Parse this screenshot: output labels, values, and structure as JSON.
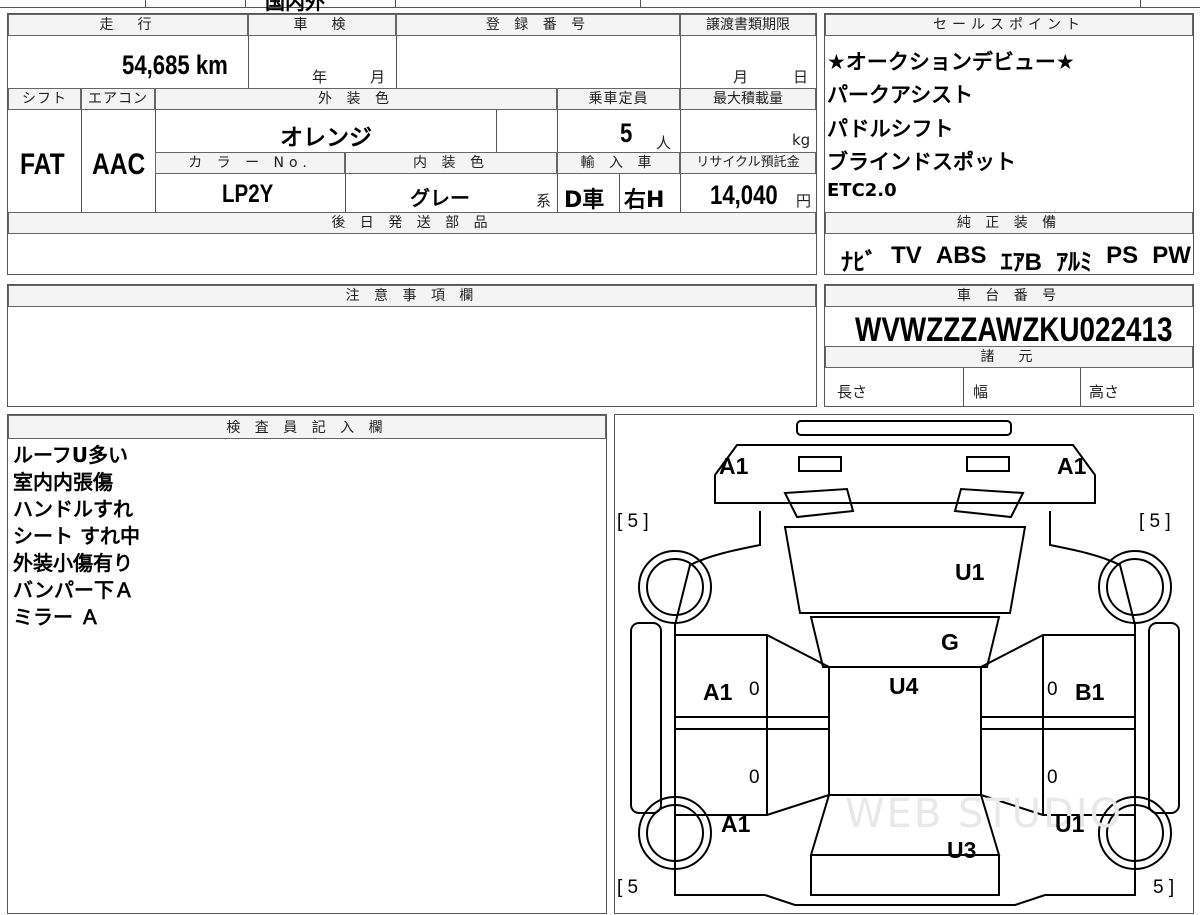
{
  "top_strip": {
    "label": "国内外"
  },
  "vehicle": {
    "mileage_header": "走　行",
    "mileage_value": "54,685 km",
    "inspection_header": "車　検",
    "inspection_year": "年",
    "inspection_month": "月",
    "registration_header": "登 録 番 号",
    "transfer_header": "譲渡書類期限",
    "transfer_month": "月",
    "transfer_day": "日",
    "shift_header": "シフト",
    "shift_value": "FAT",
    "ac_header": "エアコン",
    "ac_value": "AAC",
    "exterior_header": "外 装 色",
    "exterior_value": "オレンジ",
    "capacity_header": "乗車定員",
    "capacity_value": "5",
    "capacity_unit": "人",
    "max_load_header": "最大積載量",
    "max_load_unit": "kg",
    "color_no_header": "カ ラ ー No.",
    "color_no_value": "LP2Y",
    "interior_header": "内 装 色",
    "interior_value": "グレー",
    "interior_suffix": "系",
    "import_header": "輸 入 車",
    "import_value_1": "D車",
    "import_value_2": "右H",
    "recycle_header": "リサイクル預託金",
    "recycle_value": "14,040",
    "recycle_unit": "円",
    "later_parts_header": "後 日 発 送 部 品"
  },
  "sales_points": {
    "header": "セールスポイント",
    "items": [
      "★オークションデビュー★",
      "パークアシスト",
      "パドルシフト",
      "ブラインドスポット",
      "ETC2.0"
    ]
  },
  "equipment": {
    "header": "純 正 装 備",
    "items": [
      "ﾅﾋﾞ",
      "TV",
      "ABS",
      "ｴｱB",
      "ｱﾙﾐ",
      "PS",
      "PW"
    ]
  },
  "notes": {
    "header": "注 意 事 項 欄"
  },
  "chassis": {
    "header": "車 台 番 号",
    "value": "WVWZZZAWZKU022413",
    "spec_header": "諸　元",
    "length_label": "長さ",
    "width_label": "幅",
    "height_label": "高さ"
  },
  "inspector": {
    "header": "検 査 員 記 入 欄",
    "lines": [
      "ルーフU多い",
      "室内内張傷",
      "ハンドルすれ",
      "シート すれ中",
      "外装小傷有り",
      "バンパー下Ａ",
      "ミラー Ａ"
    ]
  },
  "diagram": {
    "tire_front_left": "[ 5 ]",
    "tire_front_right": "[ 5 ]",
    "tire_rear_left": "[ 5",
    "tire_rear_right": "5 ]",
    "front_left": "A1",
    "front_right": "A1",
    "bonnet": "U1",
    "windshield": "G",
    "roof": "U4",
    "left_front_door": "A1",
    "right_front_door": "B1",
    "left_rear": "A1",
    "right_rear": "U1",
    "trunk": "U3",
    "zero_mark": "0",
    "watermark": "WEB STUDIO"
  }
}
